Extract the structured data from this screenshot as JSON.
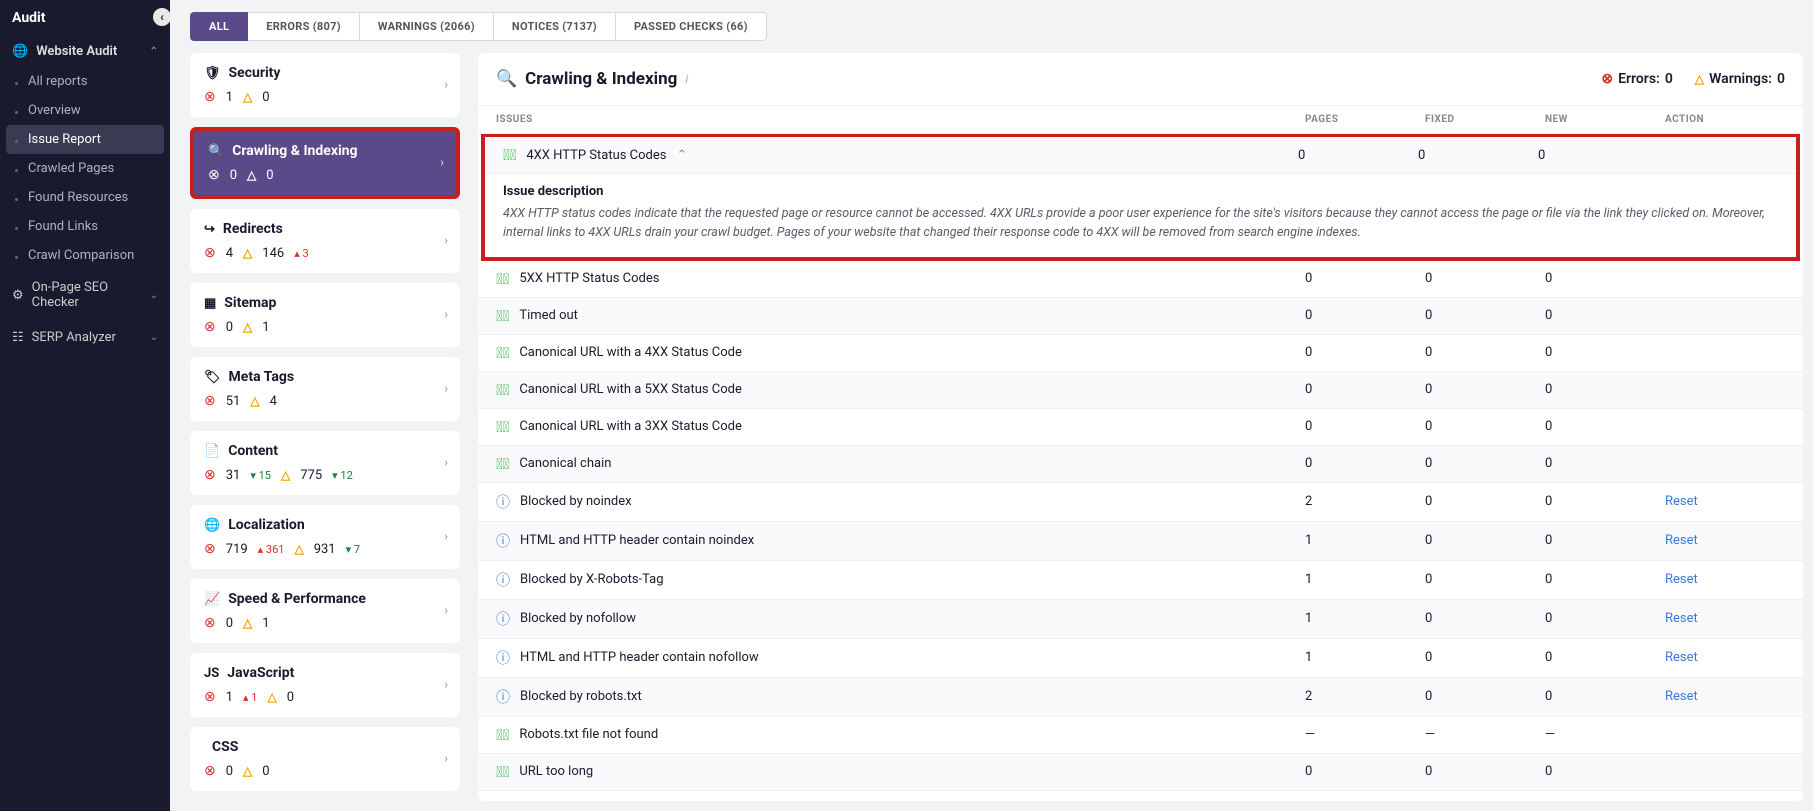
{
  "sidebar": {
    "title": "Audit",
    "main_section": "Website Audit",
    "items": [
      "All reports",
      "Overview",
      "Issue Report",
      "Crawled Pages",
      "Found Resources",
      "Found Links",
      "Crawl Comparison"
    ],
    "active_index": 2,
    "sub": [
      "On-Page SEO Checker",
      "SERP Analyzer"
    ]
  },
  "tabs": [
    {
      "label": "ALL",
      "active": true
    },
    {
      "label": "ERRORS (807)"
    },
    {
      "label": "WARNINGS (2066)"
    },
    {
      "label": "NOTICES (7137)"
    },
    {
      "label": "PASSED CHECKS (66)"
    }
  ],
  "categories": [
    {
      "icon": "shield",
      "name": "Security",
      "errors": "1",
      "warnings": "0"
    },
    {
      "icon": "search",
      "name": "Crawling & Indexing",
      "errors": "0",
      "warnings": "0",
      "active": true
    },
    {
      "icon": "redirect",
      "name": "Redirects",
      "errors": "4",
      "warnings": "146",
      "w_delta": "3",
      "w_dir": "up"
    },
    {
      "icon": "grid",
      "name": "Sitemap",
      "errors": "0",
      "warnings": "1"
    },
    {
      "icon": "tag",
      "name": "Meta Tags",
      "errors": "51",
      "warnings": "4"
    },
    {
      "icon": "doc",
      "name": "Content",
      "errors": "31",
      "e_delta": "15",
      "e_dir": "down",
      "warnings": "775",
      "w_delta": "12",
      "w_dir": "down"
    },
    {
      "icon": "globe",
      "name": "Localization",
      "errors": "719",
      "e_delta": "361",
      "e_dir": "up",
      "warnings": "931",
      "w_delta": "7",
      "w_dir": "down"
    },
    {
      "icon": "perf",
      "name": "Speed & Performance",
      "errors": "0",
      "warnings": "1"
    },
    {
      "icon": "js",
      "name": "JavaScript",
      "errors": "1",
      "e_delta": "1",
      "e_dir": "up",
      "warnings": "0"
    },
    {
      "icon": "css",
      "name": "CSS",
      "errors": "0",
      "warnings": "0"
    }
  ],
  "panel": {
    "title": "Crawling & Indexing",
    "errors_label": "Errors:",
    "errors": "0",
    "warnings_label": "Warnings:",
    "warnings": "0"
  },
  "table": {
    "headers": {
      "issues": "ISSUES",
      "pages": "PAGES",
      "fixed": "FIXED",
      "new": "NEW",
      "action": "ACTION"
    },
    "desc_title": "Issue description",
    "desc_body": "4XX HTTP status codes indicate that the requested page or resource cannot be accessed. 4XX URLs provide a poor user experience for the site's visitors because they cannot access the page or file via the link they clicked on. Moreover, internal links to 4XX URLs drain your crawl budget. Pages of your website that changed their response code to 4XX will be removed from search engine indexes.",
    "reset_label": "Reset",
    "rows": [
      {
        "status": "ok",
        "name": "4XX HTTP Status Codes",
        "pages": "0",
        "fixed": "0",
        "new": "0",
        "expanded": true,
        "highlight": true
      },
      {
        "status": "ok",
        "name": "5XX HTTP Status Codes",
        "pages": "0",
        "fixed": "0",
        "new": "0"
      },
      {
        "status": "ok",
        "name": "Timed out",
        "pages": "0",
        "fixed": "0",
        "new": "0"
      },
      {
        "status": "ok",
        "name": "Canonical URL with a 4XX Status Code",
        "pages": "0",
        "fixed": "0",
        "new": "0"
      },
      {
        "status": "ok",
        "name": "Canonical URL with a 5XX Status Code",
        "pages": "0",
        "fixed": "0",
        "new": "0"
      },
      {
        "status": "ok",
        "name": "Canonical URL with a 3XX Status Code",
        "pages": "0",
        "fixed": "0",
        "new": "0"
      },
      {
        "status": "ok",
        "name": "Canonical chain",
        "pages": "0",
        "fixed": "0",
        "new": "0"
      },
      {
        "status": "info",
        "name": "Blocked by noindex",
        "pages": "2",
        "fixed": "0",
        "new": "0",
        "action": true
      },
      {
        "status": "info",
        "name": "HTML and HTTP header contain noindex",
        "pages": "1",
        "fixed": "0",
        "new": "0",
        "action": true
      },
      {
        "status": "info",
        "name": "Blocked by X-Robots-Tag",
        "pages": "1",
        "fixed": "0",
        "new": "0",
        "action": true
      },
      {
        "status": "info",
        "name": "Blocked by nofollow",
        "pages": "1",
        "fixed": "0",
        "new": "0",
        "action": true
      },
      {
        "status": "info",
        "name": "HTML and HTTP header contain nofollow",
        "pages": "1",
        "fixed": "0",
        "new": "0",
        "action": true
      },
      {
        "status": "info",
        "name": "Blocked by robots.txt",
        "pages": "2",
        "fixed": "0",
        "new": "0",
        "action": true
      },
      {
        "status": "ok",
        "name": "Robots.txt file not found",
        "pages": "—",
        "fixed": "—",
        "new": "—"
      },
      {
        "status": "ok",
        "name": "URL too long",
        "pages": "0",
        "fixed": "0",
        "new": "0"
      }
    ]
  }
}
